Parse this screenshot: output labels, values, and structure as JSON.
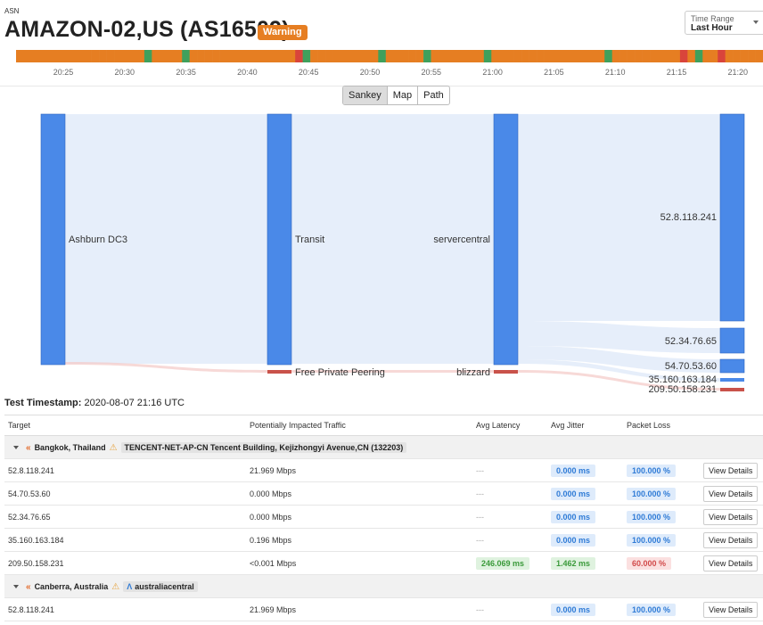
{
  "header": {
    "eyebrow": "ASN",
    "title": "AMAZON-02,US (AS16509)",
    "status": "Warning",
    "time_range_label": "Time Range",
    "time_range_value": "Last Hour"
  },
  "colors": {
    "orange": "#e67e22",
    "green": "#3fa05c",
    "red": "#d9443b",
    "blue_node": "#4a89e8",
    "link_red": "#c9524a"
  },
  "timeline": {
    "segments": [
      "o",
      "o",
      "o",
      "o",
      "o",
      "o",
      "o",
      "o",
      "o",
      "o",
      "o",
      "o",
      "o",
      "o",
      "o",
      "o",
      "o",
      "g",
      "o",
      "o",
      "o",
      "o",
      "g",
      "o",
      "o",
      "o",
      "o",
      "o",
      "o",
      "o",
      "o",
      "o",
      "o",
      "o",
      "o",
      "o",
      "o",
      "r",
      "g",
      "o",
      "o",
      "o",
      "o",
      "o",
      "o",
      "o",
      "o",
      "o",
      "g",
      "o",
      "o",
      "o",
      "o",
      "o",
      "g",
      "o",
      "o",
      "o",
      "o",
      "o",
      "o",
      "o",
      "g",
      "o",
      "o",
      "o",
      "o",
      "o",
      "o",
      "o",
      "o",
      "o",
      "o",
      "o",
      "o",
      "o",
      "o",
      "o",
      "g",
      "o",
      "o",
      "o",
      "o",
      "o",
      "o",
      "o",
      "o",
      "o",
      "r",
      "o",
      "g",
      "o",
      "o",
      "r",
      "o",
      "o",
      "o",
      "o",
      "o"
    ],
    "ticks": [
      "20:25",
      "20:30",
      "20:35",
      "20:40",
      "20:45",
      "20:50",
      "20:55",
      "21:00",
      "21:05",
      "21:10",
      "21:15",
      "21:20"
    ]
  },
  "view_toggle": [
    "Sankey",
    "Map",
    "Path"
  ],
  "sankey": {
    "nodes": {
      "ashburn": "Ashburn DC3",
      "transit": "Transit",
      "fpp": "Free Private Peering",
      "servercentral": "servercentral",
      "blizzard": "blizzard",
      "t1": "52.8.118.241",
      "t2": "52.34.76.65",
      "t3": "54.70.53.60",
      "t4": "35.160.163.184",
      "t5": "209.50.158.231"
    }
  },
  "timestamp": {
    "label": "Test Timestamp:",
    "value": "2020-08-07 21:16 UTC"
  },
  "table": {
    "columns": [
      "Target",
      "Potentially Impacted Traffic",
      "Avg Latency",
      "Avg Jitter",
      "Packet Loss"
    ],
    "view_label": "View Details",
    "groups": [
      {
        "location": "Bangkok, Thailand",
        "network": "TENCENT-NET-AP-CN Tencent Building, Kejizhongyi Avenue,CN (132203)",
        "rows": [
          {
            "target": "52.8.118.241",
            "traffic": "21.969 Mbps",
            "latency": "---",
            "jitter": "0.000 ms",
            "loss": "100.000 %"
          },
          {
            "target": "54.70.53.60",
            "traffic": "0.000 Mbps",
            "latency": "---",
            "jitter": "0.000 ms",
            "loss": "100.000 %"
          },
          {
            "target": "52.34.76.65",
            "traffic": "0.000 Mbps",
            "latency": "---",
            "jitter": "0.000 ms",
            "loss": "100.000 %"
          },
          {
            "target": "35.160.163.184",
            "traffic": "0.196 Mbps",
            "latency": "---",
            "jitter": "0.000 ms",
            "loss": "100.000 %"
          },
          {
            "target": "209.50.158.231",
            "traffic": "<0.001 Mbps",
            "latency": "246.069 ms",
            "jitter": "1.462 ms",
            "loss": "60.000 %"
          }
        ]
      },
      {
        "location": "Canberra, Australia",
        "network": "australiacentral",
        "rows": [
          {
            "target": "52.8.118.241",
            "traffic": "21.969 Mbps",
            "latency": "---",
            "jitter": "0.000 ms",
            "loss": "100.000 %"
          }
        ]
      }
    ]
  }
}
